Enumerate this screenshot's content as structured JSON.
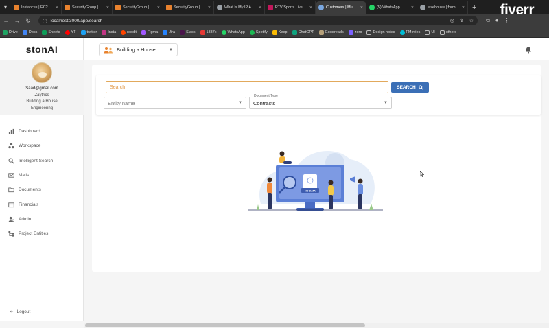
{
  "browser": {
    "tabs": [
      {
        "label": "Instances | EC2",
        "color": "#e8822e"
      },
      {
        "label": "SecurityGroup |",
        "color": "#e8822e"
      },
      {
        "label": "SecurityGroup |",
        "color": "#e8822e"
      },
      {
        "label": "SecurityGroup |",
        "color": "#e8822e"
      },
      {
        "label": "What Is My IP A",
        "color": "#9aa0a6"
      },
      {
        "label": "PTV Sports Live",
        "color": "#c2185b"
      },
      {
        "label": "Customers | Mu",
        "color": "#7aa7e0"
      },
      {
        "label": "(5) WhatsApp",
        "color": "#25d366"
      },
      {
        "label": "elsehouse | form",
        "color": "#9aa0a6"
      }
    ],
    "url": "localhost:3000/app/search",
    "bookmarks": [
      {
        "label": "Drive",
        "color": "#1fa463"
      },
      {
        "label": "Docs",
        "color": "#4285f4"
      },
      {
        "label": "Sheets",
        "color": "#0f9d58"
      },
      {
        "label": "YT",
        "color": "#ff0000"
      },
      {
        "label": "twitter",
        "color": "#1da1f2"
      },
      {
        "label": "Insta",
        "color": "#c13584"
      },
      {
        "label": "reddit",
        "color": "#ff4500"
      },
      {
        "label": "Figma",
        "color": "#a259ff"
      },
      {
        "label": "Jira",
        "color": "#2684ff"
      },
      {
        "label": "Slack",
        "color": "#4a154b"
      },
      {
        "label": "1337x",
        "color": "#e53935"
      },
      {
        "label": "WhatsApp",
        "color": "#25d366"
      },
      {
        "label": "Spotify",
        "color": "#1db954"
      },
      {
        "label": "Keep",
        "color": "#fbbc04"
      },
      {
        "label": "ChatGPT",
        "color": "#10a37f"
      },
      {
        "label": "Goodreads",
        "color": "#b5a07a"
      },
      {
        "label": "zoro",
        "color": "#7b61ff"
      },
      {
        "label": "Design notes",
        "color": "#9aa0a6"
      },
      {
        "label": "FMovies",
        "color": "#00bcd4"
      },
      {
        "label": "UI",
        "color": "#9aa0a6"
      },
      {
        "label": "others",
        "color": "#9aa0a6"
      }
    ],
    "watermark": "fiverr"
  },
  "app": {
    "logo": "stonAI",
    "user": {
      "email": "Saad@gmail.com",
      "company": "Zaytrics",
      "project": "Building a House",
      "department": "Engineering"
    },
    "nav": [
      {
        "label": "Dashboard",
        "icon": "bar-chart-icon"
      },
      {
        "label": "Workspace",
        "icon": "workspace-icon"
      },
      {
        "label": "Intelligent Search",
        "icon": "search-icon"
      },
      {
        "label": "Mails",
        "icon": "mail-icon"
      },
      {
        "label": "Documents",
        "icon": "folder-icon"
      },
      {
        "label": "Financials",
        "icon": "wallet-icon"
      },
      {
        "label": "Admin",
        "icon": "admin-icon"
      },
      {
        "label": "Project Entities",
        "icon": "hierarchy-icon"
      }
    ],
    "logout_label": "Logout",
    "topbar": {
      "project_select": "Building a House"
    },
    "search": {
      "placeholder": "Search",
      "button_label": "SEARCH",
      "entity_placeholder": "Entity name",
      "doc_type_label": "Document Type",
      "doc_type_value": "Contracts"
    },
    "empty_state": {
      "badge_text": "NO DATA"
    },
    "colors": {
      "accent_blue": "#3b6fb6",
      "search_border": "#e2a95c"
    }
  }
}
